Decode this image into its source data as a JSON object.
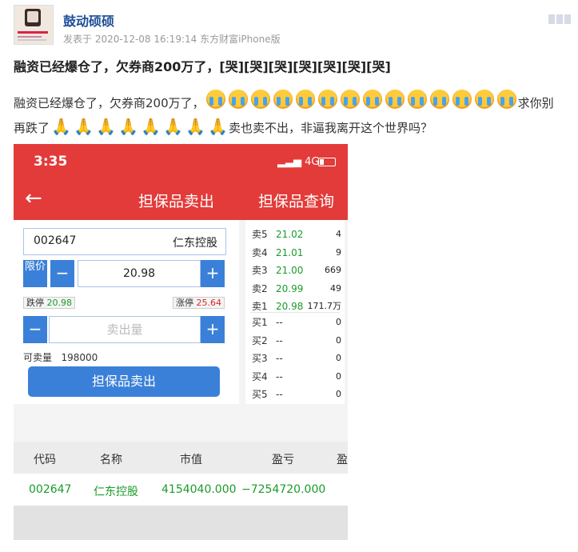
{
  "post": {
    "username": "鼓动硕硕",
    "meta": "发表于 2020-12-08 16:19:14 东方财富iPhone版",
    "title": "融资已经爆仓了，欠券商200万了，[哭][哭][哭][哭][哭][哭][哭]",
    "body_line1_text": "融资已经爆仓了，欠券商200万了，",
    "body_line1_tail": "求你别",
    "body_line2_head": "再跌了",
    "body_line2_tail": "卖也卖不出，非逼我离开这个世界吗？",
    "cry_emoji_count": 14,
    "pray_emoji_count": 8
  },
  "phone": {
    "status": {
      "time": "3:35",
      "network": "4G"
    },
    "nav": {
      "back": "←",
      "title": "担保品卖出",
      "link": "担保品查询"
    },
    "form": {
      "code": "002647",
      "name": "仁东控股",
      "limit_label": "限价",
      "price": "20.98",
      "minus": "−",
      "plus": "+",
      "limit_down_label": "跌停",
      "limit_down": "20.98",
      "limit_up_label": "涨停",
      "limit_up": "25.64",
      "qty_placeholder": "卖出量",
      "avail_label": "可卖量",
      "avail_value": "198000",
      "sell_button": "担保品卖出"
    },
    "orderbook": [
      {
        "label": "卖5",
        "price": "21.02",
        "volume": "4"
      },
      {
        "label": "卖4",
        "price": "21.01",
        "volume": "9"
      },
      {
        "label": "卖3",
        "price": "21.00",
        "volume": "669"
      },
      {
        "label": "卖2",
        "price": "20.99",
        "volume": "49"
      },
      {
        "label": "卖1",
        "price": "20.98",
        "volume": "171.7万"
      },
      {
        "label": "买1",
        "price": "--",
        "volume": "0"
      },
      {
        "label": "买2",
        "price": "--",
        "volume": "0"
      },
      {
        "label": "买3",
        "price": "--",
        "volume": "0"
      },
      {
        "label": "买4",
        "price": "--",
        "volume": "0"
      },
      {
        "label": "买5",
        "price": "--",
        "volume": "0"
      }
    ],
    "table": {
      "headers": [
        "代码",
        "名称",
        "市值",
        "盈亏",
        "盈"
      ],
      "row": [
        "002647",
        "仁东控股",
        "4154040.000",
        "−7254720.000"
      ]
    }
  },
  "colors": {
    "header_red": "#e23b39",
    "button_blue": "#3b80d8",
    "green": "#1a9b2a",
    "username_blue": "#1d4d97"
  }
}
